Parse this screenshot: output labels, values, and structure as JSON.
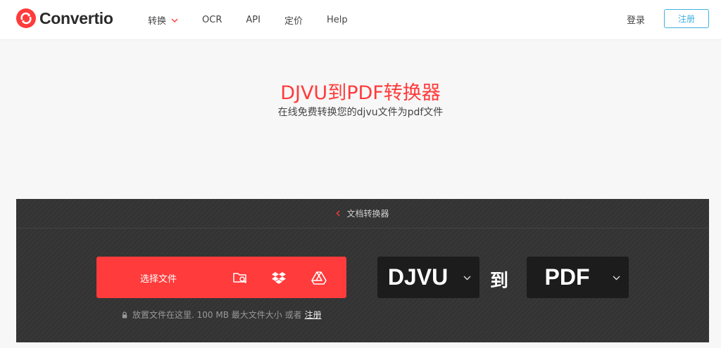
{
  "brand": {
    "name": "Convertio",
    "color": "#ff3b3b"
  },
  "nav": {
    "convert": "转换",
    "ocr": "OCR",
    "api": "API",
    "pricing": "定价",
    "help": "Help"
  },
  "auth": {
    "login": "登录",
    "signup": "注册"
  },
  "hero": {
    "title": "DJVU到PDF转换器",
    "subtitle": "在线免费转换您的djvu文件为pdf文件"
  },
  "converter": {
    "breadcrumb": "文档转换器",
    "choose_files": "选择文件",
    "sources": [
      "folder-search-icon",
      "dropbox-icon",
      "google-drive-icon"
    ],
    "drop_note": "放置文件在这里. 100 MB 最大文件大小 或者",
    "drop_note_link": "注册",
    "from_format": "DJVU",
    "to_word": "到",
    "to_format": "PDF"
  },
  "colors": {
    "accent": "#ff3b3b",
    "signup_border": "#3fb0e0",
    "panel_bg": "#333333",
    "format_bg": "#1c1c1c"
  }
}
